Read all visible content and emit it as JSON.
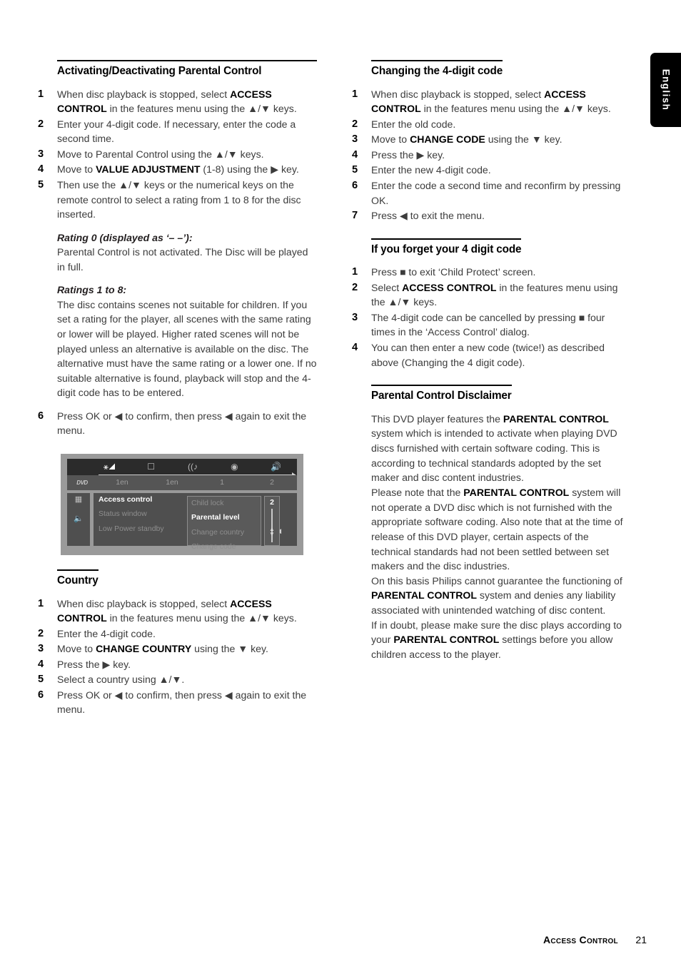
{
  "language_tab": {
    "label": "English"
  },
  "footer": {
    "title": "Access Control",
    "page": "21"
  },
  "left_column": {
    "section1": {
      "heading": "Activating/Deactivating Parental Control",
      "steps": [
        "When disc playback is stopped, select <b>ACCESS CONTROL</b> in the features menu using the ▲/▼ keys.",
        "Enter your 4-digit code. If necessary, enter the code a second time.",
        "Move to Parental Control using the ▲/▼ keys.",
        "Move to <b>VALUE ADJUSTMENT</b> (1-8) using the ▶ key.",
        "Then use the ▲/▼ keys or the numerical keys on the remote control to select a rating from 1 to 8 for the disc inserted."
      ],
      "note1_title": "Rating 0 (displayed as ‘– –’):",
      "note1_body": "Parental Control is not activated. The Disc will be played in full.",
      "note2_title": "Ratings 1 to 8:",
      "note2_body": "The disc contains scenes not suitable for children. If you set a rating for the player, all scenes with the same rating or lower will be played. Higher rated scenes will not be played unless an alternative is available on the disc. The alternative must have the same rating or a lower one. If no suitable alternative is found, playback will stop and the 4-digit code has to be entered.",
      "step6": "Press OK or ◀ to confirm, then press ◀ again to exit the menu."
    },
    "osd": {
      "top_icons": [
        "tools-icon",
        "subtitle-icon",
        "audio-icon",
        "disc-icon",
        "speaker-icon"
      ],
      "top_values": [
        "1en",
        "1en",
        "1",
        "2"
      ],
      "disc_label": "DVD",
      "side_icons": [
        "picture-icon",
        "sound-icon"
      ],
      "menu_column1": [
        "Access control",
        "Status window",
        "Low Power standby"
      ],
      "menu_column1_selected": "Access control",
      "menu_column2": [
        "Child lock",
        "Parental level",
        "Change country",
        "Change code"
      ],
      "menu_column2_selected": "Parental level",
      "slider_value": "2"
    },
    "section2": {
      "heading": "Country",
      "steps": [
        "When disc playback is stopped, select <b>ACCESS CONTROL</b> in the features menu using the ▲/▼ keys.",
        "Enter the 4-digit code.",
        "Move to <b>CHANGE COUNTRY</b> using the ▼ key.",
        "Press the ▶ key.",
        "Select a country using ▲/▼.",
        "Press OK or ◀ to confirm, then press ◀ again to exit the menu."
      ]
    }
  },
  "right_column": {
    "section1": {
      "heading": "Changing the 4-digit code",
      "steps": [
        "When disc playback is stopped, select <b>ACCESS CONTROL</b> in the features menu using the ▲/▼ keys.",
        "Enter the old code.",
        "Move to <b>CHANGE CODE</b> using the ▼ key.",
        "Press the ▶ key.",
        "Enter the new 4-digit code.",
        "Enter the code a second time and reconfirm by pressing OK.",
        "Press ◀ to exit the menu."
      ]
    },
    "section2": {
      "heading": "If you forget your 4 digit code",
      "steps": [
        "Press ■ to exit ‘Child Protect’ screen.",
        "Select <b>ACCESS CONTROL</b> in the features menu using the ▲/▼ keys.",
        "The 4-digit code can be cancelled by pressing ■ four times in the ‘Access Control’ dialog.",
        "You can then enter a new code (twice!) as described above (Changing the 4 digit code)."
      ]
    },
    "section3": {
      "heading": "Parental Control Disclaimer",
      "paragraphs": [
        "This DVD player features the <b>PARENTAL CONTROL</b> system which is intended to activate when playing DVD discs furnished with certain software coding. This is according to technical standards adopted by the set maker and disc content industries.",
        "Please note that the <b>PARENTAL CONTROL</b> system will not operate a DVD disc which is not furnished with the appropriate software coding. Also note that at the time of release of this DVD player, certain aspects of the technical standards had not been settled between set makers and the disc industries.",
        "On this basis Philips cannot guarantee the functioning of <b>PARENTAL CONTROL</b> system and denies any liability associated with unintended watching of disc content.",
        "If in doubt, please make sure the disc plays according to your <b>PARENTAL CONTROL</b> settings before you allow children access to the player."
      ]
    }
  }
}
